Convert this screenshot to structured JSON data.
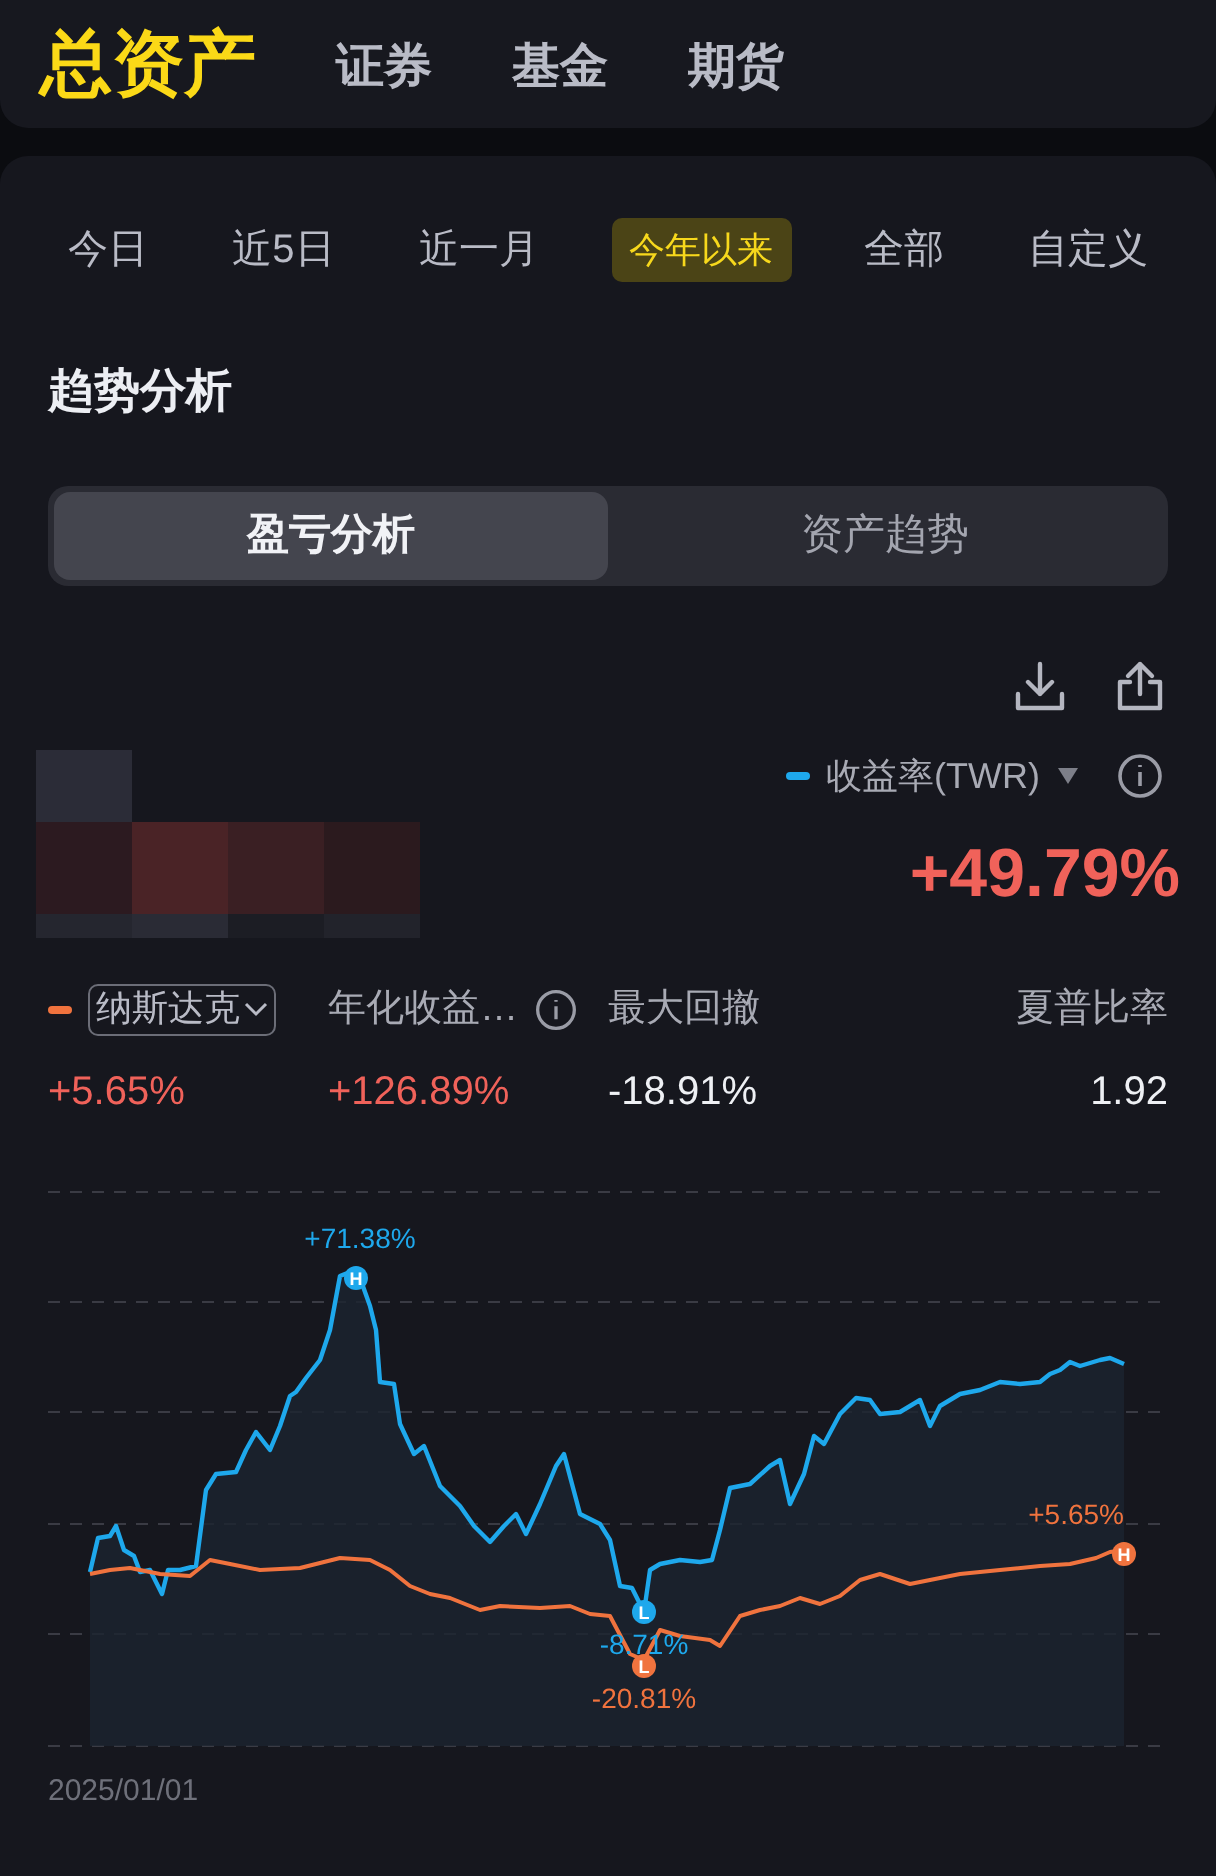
{
  "header_tabs": [
    {
      "label": "总资产",
      "selected": true
    },
    {
      "label": "证券",
      "selected": false
    },
    {
      "label": "基金",
      "selected": false
    },
    {
      "label": "期货",
      "selected": false
    }
  ],
  "periods": [
    {
      "label": "今日",
      "selected": false
    },
    {
      "label": "近5日",
      "selected": false
    },
    {
      "label": "近一月",
      "selected": false
    },
    {
      "label": "今年以来",
      "selected": true
    },
    {
      "label": "全部",
      "selected": false
    },
    {
      "label": "自定义",
      "selected": false
    }
  ],
  "section_title": "趋势分析",
  "segments": [
    {
      "label": "盈亏分析",
      "selected": true
    },
    {
      "label": "资产趋势",
      "selected": false
    }
  ],
  "balance": {
    "kind": "pixelated"
  },
  "return_metric": {
    "label": "收益率(TWR)",
    "value": "+49.79%",
    "color": "#1ea8ec"
  },
  "benchmark": {
    "label": "纳斯达克",
    "value": "+5.65%",
    "color": "#f0733e"
  },
  "stats": [
    {
      "label": "年化收益…",
      "value": "+126.89%",
      "color": "#f0625a",
      "info": true
    },
    {
      "label": "最大回撤",
      "value": "-18.91%",
      "color": "#eef0f4",
      "info": false
    },
    {
      "label": "夏普比率",
      "value": "1.92",
      "color": "#eef0f4",
      "info": false
    }
  ],
  "chart": {
    "labels": [
      {
        "color": "#1ea8ec",
        "kind": "high",
        "marker": "H",
        "text": "+71.38%"
      },
      {
        "color": "#1ea8ec",
        "kind": "low",
        "marker": "L",
        "text": "-8.71%"
      },
      {
        "color": "#f0733e",
        "kind": "low",
        "marker": "L",
        "text": "-20.81%"
      },
      {
        "color": "#f0733e",
        "kind": "high",
        "marker": "H",
        "text": "+5.65%"
      }
    ],
    "start_date": "2025/01/01"
  }
}
